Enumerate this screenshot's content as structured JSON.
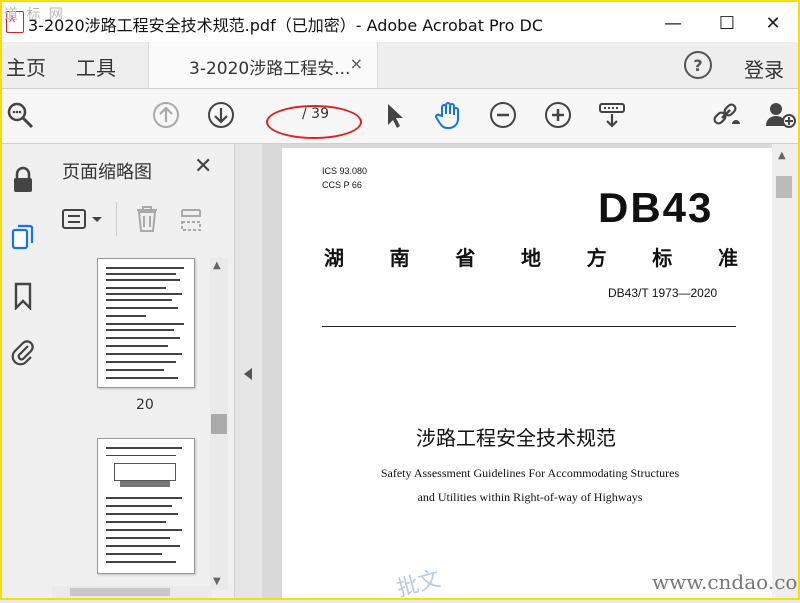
{
  "window": {
    "title": "3-2020涉路工程安全技术规范.pdf（已加密）- Adobe Acrobat Pro DC",
    "watermark_logo": "道 标 网",
    "controls": {
      "minimize": "—",
      "maximize": "☐",
      "close": "✕"
    }
  },
  "menubar": {
    "home": "主页",
    "tools": "工具",
    "doc_tab": "3-2020涉路工程安...",
    "doc_tab_close": "×",
    "help": "?",
    "login": "登录"
  },
  "toolbar": {
    "page_current": "",
    "page_total": "/ 39",
    "icons": [
      "search-icon",
      "up-arrow-icon",
      "down-arrow-icon",
      "select-arrow-icon",
      "hand-icon",
      "zoom-out-icon",
      "zoom-in-icon",
      "read-mode-icon",
      "share-link-icon",
      "add-user-icon"
    ]
  },
  "sidebar": {
    "icons": [
      "lock-icon",
      "page-thumbnails-icon",
      "bookmark-icon",
      "attachment-icon"
    ],
    "panel_title": "页面缩略图",
    "close": "✕",
    "thumbnails": [
      {
        "label": "20"
      },
      {
        "label": ""
      }
    ]
  },
  "document": {
    "ics": "ICS 93.080",
    "ccs": "CCS P 66",
    "code": "DB43",
    "standard_type_chars": [
      "湖",
      "南",
      "省",
      "地",
      "方",
      "标",
      "准"
    ],
    "standard_number": "DB43/T 1973—2020",
    "title_cn": "涉路工程安全技术规范",
    "title_en_1": "Safety Assessment Guidelines For Accommodating Structures",
    "title_en_2": "and Utilities within Right-of-way of Highways"
  },
  "watermark": {
    "text": "www.cndao.com",
    "faint": "批文"
  },
  "colors": {
    "highlight_oval": "#e02020",
    "frame": "#f5e000",
    "active_icon": "#1473e6"
  }
}
